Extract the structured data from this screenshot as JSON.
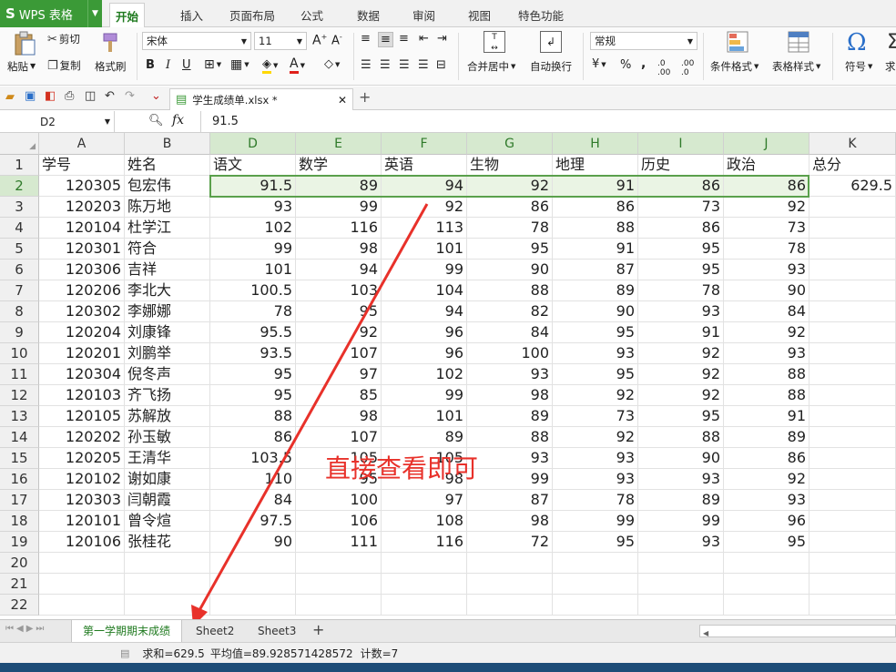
{
  "app": {
    "logo": "S",
    "name": "WPS 表格"
  },
  "menu": [
    "开始",
    "插入",
    "页面布局",
    "公式",
    "数据",
    "审阅",
    "视图",
    "特色功能"
  ],
  "ribbon": {
    "paste": "粘贴",
    "cut": "剪切",
    "copy": "复制",
    "format_painter": "格式刷",
    "font_name": "宋体",
    "font_size": "11",
    "merge_center": "合并居中",
    "wrap_text": "自动换行",
    "number_format": "常规",
    "percent": "%",
    "thousands": ",",
    "conditional_format": "条件格式",
    "table_style": "表格样式",
    "symbol": "符号",
    "sum": "求"
  },
  "document": {
    "tab_title": "学生成绩单.xlsx *"
  },
  "formula_bar": {
    "cell_ref": "D2",
    "fx": "fx",
    "value": "91.5"
  },
  "sheet": {
    "columns": [
      "A",
      "B",
      "D",
      "E",
      "F",
      "G",
      "H",
      "I",
      "J",
      "K"
    ],
    "rows": [
      [
        "学号",
        "姓名",
        "语文",
        "数学",
        "英语",
        "生物",
        "地理",
        "历史",
        "政治",
        "总分"
      ],
      [
        "120305",
        "包宏伟",
        "91.5",
        "89",
        "94",
        "92",
        "91",
        "86",
        "86",
        "629.5"
      ],
      [
        "120203",
        "陈万地",
        "93",
        "99",
        "92",
        "86",
        "86",
        "73",
        "92",
        ""
      ],
      [
        "120104",
        "杜学江",
        "102",
        "116",
        "113",
        "78",
        "88",
        "86",
        "73",
        ""
      ],
      [
        "120301",
        "符合",
        "99",
        "98",
        "101",
        "95",
        "91",
        "95",
        "78",
        ""
      ],
      [
        "120306",
        "吉祥",
        "101",
        "94",
        "99",
        "90",
        "87",
        "95",
        "93",
        ""
      ],
      [
        "120206",
        "李北大",
        "100.5",
        "103",
        "104",
        "88",
        "89",
        "78",
        "90",
        ""
      ],
      [
        "120302",
        "李娜娜",
        "78",
        "95",
        "94",
        "82",
        "90",
        "93",
        "84",
        ""
      ],
      [
        "120204",
        "刘康锋",
        "95.5",
        "92",
        "96",
        "84",
        "95",
        "91",
        "92",
        ""
      ],
      [
        "120201",
        "刘鹏举",
        "93.5",
        "107",
        "96",
        "100",
        "93",
        "92",
        "93",
        ""
      ],
      [
        "120304",
        "倪冬声",
        "95",
        "97",
        "102",
        "93",
        "95",
        "92",
        "88",
        ""
      ],
      [
        "120103",
        "齐飞扬",
        "95",
        "85",
        "99",
        "98",
        "92",
        "92",
        "88",
        ""
      ],
      [
        "120105",
        "苏解放",
        "88",
        "98",
        "101",
        "89",
        "73",
        "95",
        "91",
        ""
      ],
      [
        "120202",
        "孙玉敏",
        "86",
        "107",
        "89",
        "88",
        "92",
        "88",
        "89",
        ""
      ],
      [
        "120205",
        "王清华",
        "103.5",
        "105",
        "105",
        "93",
        "93",
        "90",
        "86",
        ""
      ],
      [
        "120102",
        "谢如康",
        "110",
        "95",
        "98",
        "99",
        "93",
        "93",
        "92",
        ""
      ],
      [
        "120303",
        "闫朝霞",
        "84",
        "100",
        "97",
        "87",
        "78",
        "89",
        "93",
        ""
      ],
      [
        "120101",
        "曾令煊",
        "97.5",
        "106",
        "108",
        "98",
        "99",
        "99",
        "96",
        ""
      ],
      [
        "120106",
        "张桂花",
        "90",
        "111",
        "116",
        "72",
        "95",
        "93",
        "95",
        ""
      ],
      [
        "",
        "",
        "",
        "",
        "",
        "",
        "",
        "",
        "",
        ""
      ],
      [
        "",
        "",
        "",
        "",
        "",
        "",
        "",
        "",
        "",
        ""
      ],
      [
        "",
        "",
        "",
        "",
        "",
        "",
        "",
        "",
        "",
        ""
      ]
    ]
  },
  "annotation": "直接查看即可",
  "sheet_tabs": [
    "第一学期期末成绩",
    "Sheet2",
    "Sheet3"
  ],
  "status": {
    "sum": "求和=629.5",
    "average": "平均值=89.928571428572",
    "count": "计数=7"
  },
  "colors": {
    "accent": "#3b9a37",
    "selection": "#d6e9cf",
    "annotation": "#e8312a"
  }
}
